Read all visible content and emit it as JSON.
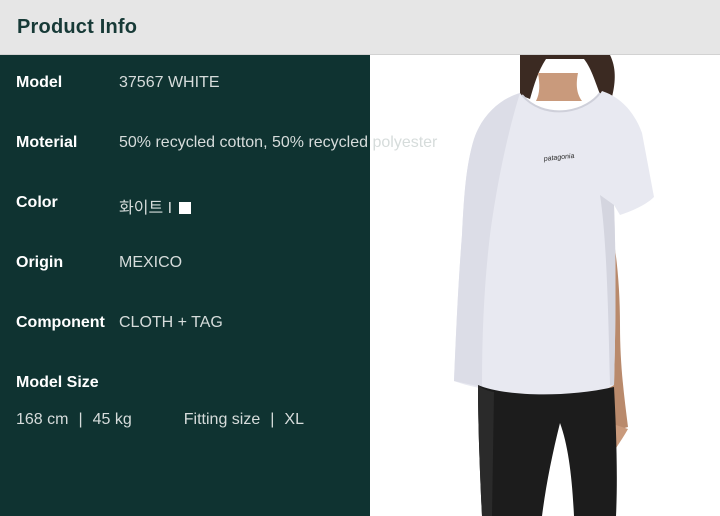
{
  "header": {
    "title": "Product Info"
  },
  "specs": [
    {
      "label": "Model",
      "value": "37567 WHITE"
    },
    {
      "label": "Moterial",
      "value": "50% recycled cotton, 50% recycled polyester"
    },
    {
      "label": "Color",
      "value": "화이트 I"
    },
    {
      "label": "Origin",
      "value": "MEXICO"
    },
    {
      "label": "Component",
      "value": "CLOTH + TAG"
    }
  ],
  "model_size": {
    "label": "Model Size",
    "height": "168 cm",
    "separator": "|",
    "weight": "45 kg",
    "fitting_label": "Fitting size",
    "fitting_value": "XL"
  },
  "colors": {
    "panel_bg": "#0f3331",
    "header_bg": "#e6e6e6",
    "header_text": "#173a37",
    "shirt": "#e8e9f1",
    "pants": "#1c1c1c",
    "skin": "#c99a7c"
  },
  "image": {
    "logo_text": "patagonia"
  }
}
